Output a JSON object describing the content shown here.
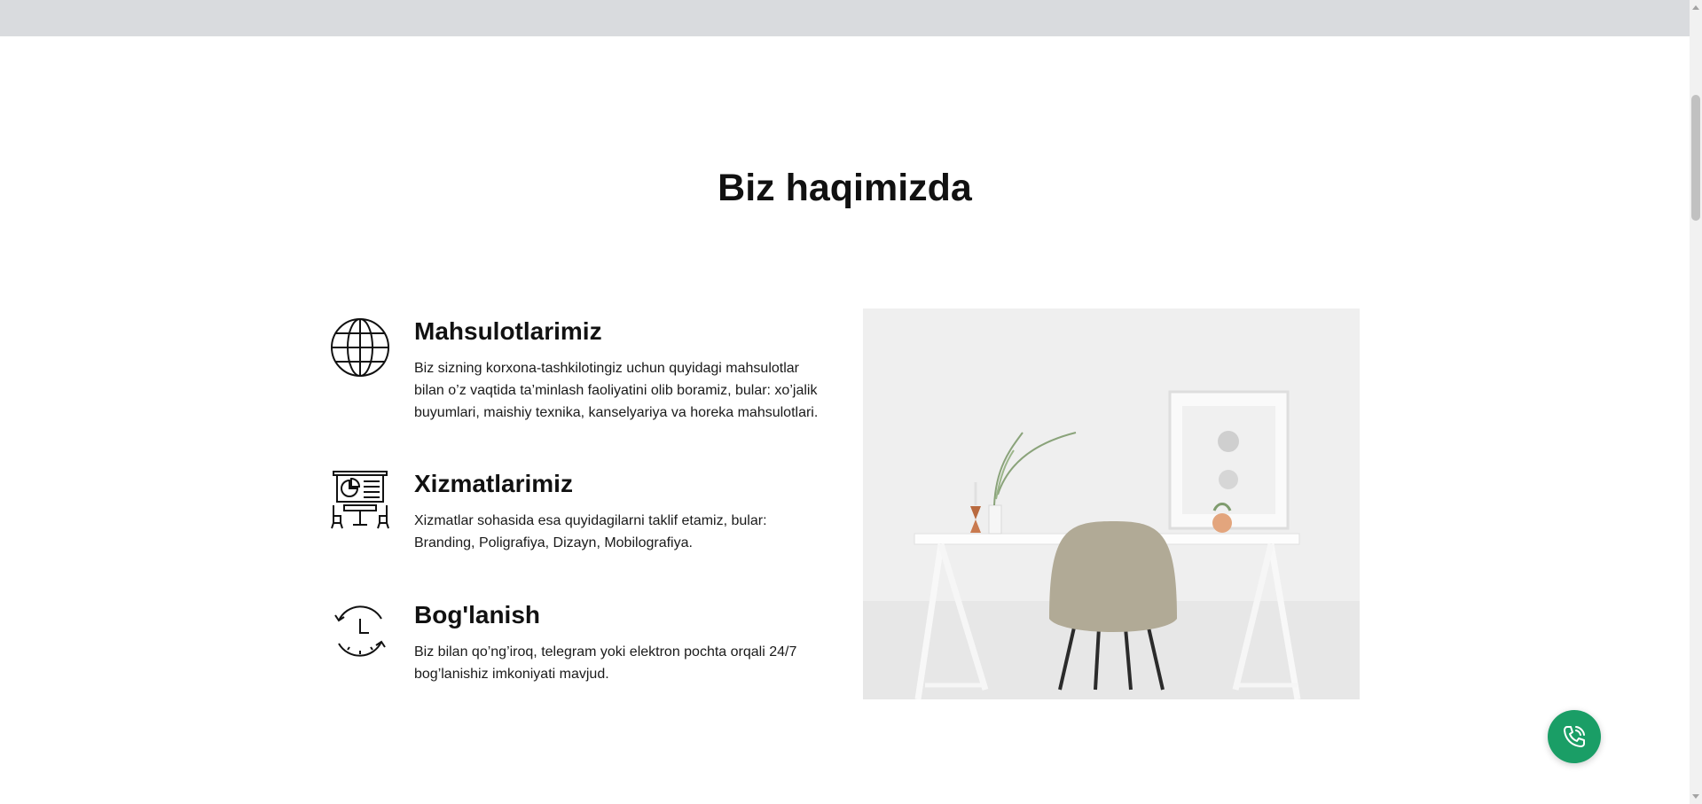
{
  "section": {
    "title": "Biz haqimizda"
  },
  "features": [
    {
      "icon": "globe-icon",
      "title": "Mahsulotlarimiz",
      "text": "Biz sizning korxona-tashkilotingiz uchun quyidagi mahsulotlar bilan o’z vaqtida ta’minlash faoliyatini olib boramiz, bular: xo’jalik buyumlari, maishiy texnika, kanselyariya va horeka mahsulotlari."
    },
    {
      "icon": "presentation-board-icon",
      "title": "Xizmatlarimiz",
      "text": "Xizmatlar sohasida esa quyidagilarni taklif etamiz, bular: Branding, Poligrafiya, Dizayn, Mobilografiya."
    },
    {
      "icon": "clock-refresh-icon",
      "title": "Bog'lanish",
      "text": "Biz bilan qo’ng’iroq, telegram yoki elektron pochta orqali 24/7 bog’lanishiz imkoniyati mavjud."
    }
  ],
  "image": {
    "subject": "desk-chair-photo"
  },
  "call_button": {
    "icon": "phone-call-icon",
    "color": "#1a9e66"
  },
  "colors": {
    "topbar": "#d9dbde",
    "accent": "#1a9e66"
  }
}
